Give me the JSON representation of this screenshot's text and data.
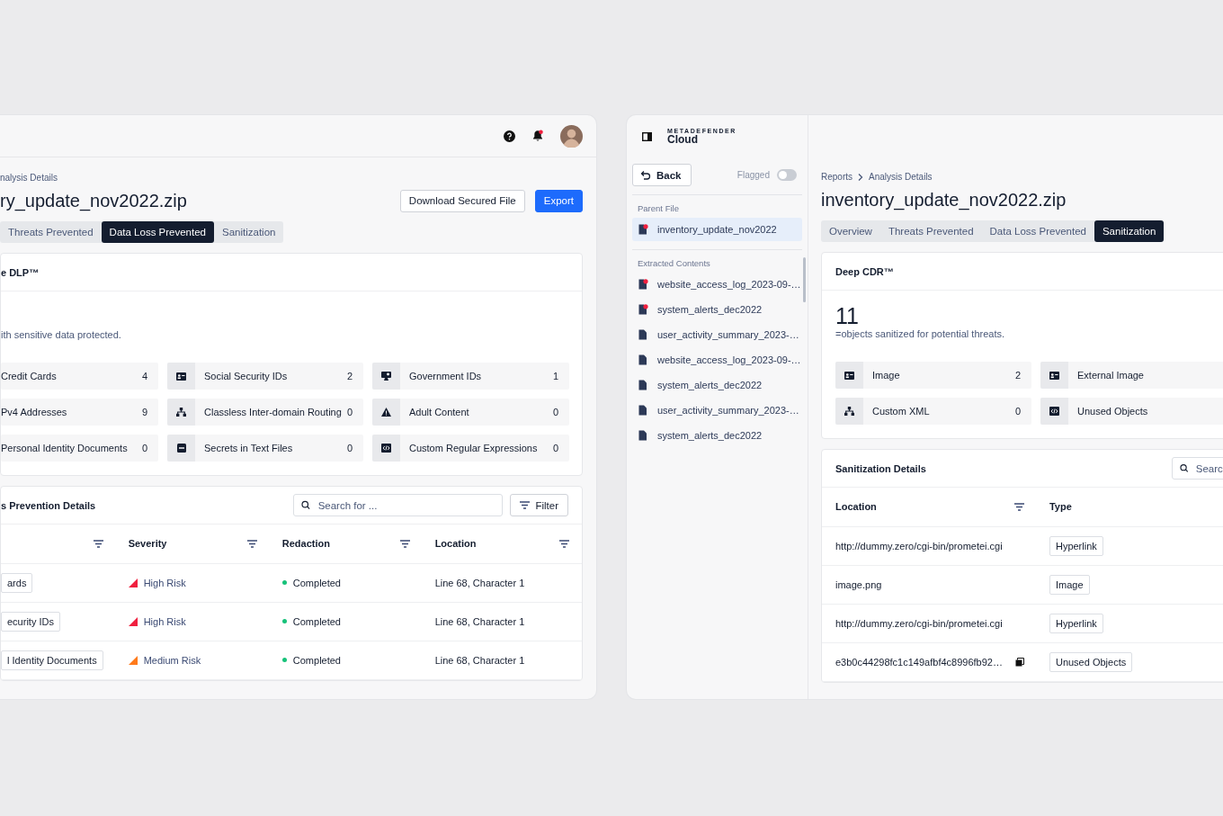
{
  "left_window": {
    "breadcrumb": "nalysis Details",
    "title": "ry_update_nov2022.zip",
    "actions": [
      {
        "label": "Download Secured File",
        "kind": "secondary"
      },
      {
        "label": "Export",
        "kind": "primary"
      }
    ],
    "tabs": [
      {
        "label": "Threats Prevented",
        "selected": false
      },
      {
        "label": "Data Loss Prevented",
        "selected": true
      },
      {
        "label": "Sanitization",
        "selected": false
      }
    ],
    "summary": {
      "title": "e DLP™",
      "description": "ith sensitive data protected.",
      "categories": [
        {
          "label": "Credit Cards",
          "count": "4"
        },
        {
          "label": "Social Security IDs",
          "count": "2"
        },
        {
          "label": "Government IDs",
          "count": "1"
        },
        {
          "label": "Pv4 Addresses",
          "count": "9"
        },
        {
          "label": "Classless Inter-domain Routing",
          "count": "0"
        },
        {
          "label": "Adult Content",
          "count": "0"
        },
        {
          "label": "Personal Identity Documents",
          "count": "0"
        },
        {
          "label": "Secrets in Text Files",
          "count": "0"
        },
        {
          "label": "Custom Regular Expressions",
          "count": "0"
        }
      ]
    },
    "table": {
      "title": "s Prevention Details",
      "search": {
        "placeholder": "Search for ..."
      },
      "filter_button": "Filter",
      "columns": [
        {
          "filter": true
        },
        {
          "label": "Severity",
          "filter": true
        },
        {
          "label": "Redaction",
          "filter": true
        },
        {
          "label": "Location",
          "filter": true
        }
      ],
      "rows": [
        {
          "category": "ards",
          "severity": {
            "label": "High Risk",
            "color": "#f0203f"
          },
          "redaction": {
            "label": "Completed",
            "color": "#17c27a"
          },
          "location": "Line 68, Character 1"
        },
        {
          "category": "ecurity IDs",
          "severity": {
            "label": "High Risk",
            "color": "#f0203f"
          },
          "redaction": {
            "label": "Completed",
            "color": "#17c27a"
          },
          "location": "Line 68, Character 1"
        },
        {
          "category": "l Identity Documents",
          "severity": {
            "label": "Medium Risk",
            "color": "#ff7a1a"
          },
          "redaction": {
            "label": "Completed",
            "color": "#17c27a"
          },
          "location": "Line 68, Character 1"
        }
      ]
    }
  },
  "right_window": {
    "sidebar": {
      "brand": {
        "tagline": "METADEFENDER",
        "name": "Cloud"
      },
      "back_button": "Back",
      "flagged": {
        "label": "Flagged",
        "on": false
      },
      "sections": [
        {
          "title": "Parent File",
          "files": [
            {
              "name": "inventory_update_nov2022",
              "flagged": true,
              "selected": true
            }
          ]
        },
        {
          "title": "Extracted Contents",
          "files": [
            {
              "name": "website_access_log_2023-09-…",
              "flagged": true,
              "selected": false
            },
            {
              "name": "system_alerts_dec2022",
              "flagged": true,
              "selected": false
            },
            {
              "name": "user_activity_summary_2023-…",
              "flagged": false,
              "selected": false
            },
            {
              "name": "website_access_log_2023-09-…",
              "flagged": false,
              "selected": false
            },
            {
              "name": "system_alerts_dec2022",
              "flagged": false,
              "selected": false
            },
            {
              "name": "user_activity_summary_2023-…",
              "flagged": false,
              "selected": false
            },
            {
              "name": "system_alerts_dec2022",
              "flagged": false,
              "selected": false
            }
          ]
        }
      ]
    },
    "main": {
      "breadcrumb": [
        "Reports",
        "Analysis Details"
      ],
      "title": "inventory_update_nov2022.zip",
      "tabs": [
        {
          "label": "Overview",
          "selected": false
        },
        {
          "label": "Threats Prevented",
          "selected": false
        },
        {
          "label": "Data Loss Prevented",
          "selected": false
        },
        {
          "label": "Sanitization",
          "selected": true
        }
      ],
      "summary": {
        "title": "Deep CDR™",
        "count": "11",
        "description": "=objects sanitized for potential threats.",
        "categories": [
          {
            "label": "Image",
            "count": "2"
          },
          {
            "label": "External Image"
          },
          {
            "label": "Custom XML",
            "count": "0"
          },
          {
            "label": "Unused Objects"
          }
        ]
      },
      "table": {
        "title": "Sanitization Details",
        "search": {
          "placeholder": "Searc"
        },
        "columns": [
          {
            "label": "Location",
            "filter": true
          },
          {
            "label": "Type",
            "filter": false
          }
        ],
        "rows": [
          {
            "location": "http://dummy.zero/cgi-bin/prometei.cgi",
            "type": "Hyperlink",
            "copy": false
          },
          {
            "location": "image.png",
            "type": "Image",
            "copy": false
          },
          {
            "location": "http://dummy.zero/cgi-bin/prometei.cgi",
            "type": "Hyperlink",
            "copy": false
          },
          {
            "location": "e3b0c44298fc1c149afbf4c8996fb92…",
            "type": "Unused Objects",
            "copy": true
          }
        ]
      }
    }
  }
}
